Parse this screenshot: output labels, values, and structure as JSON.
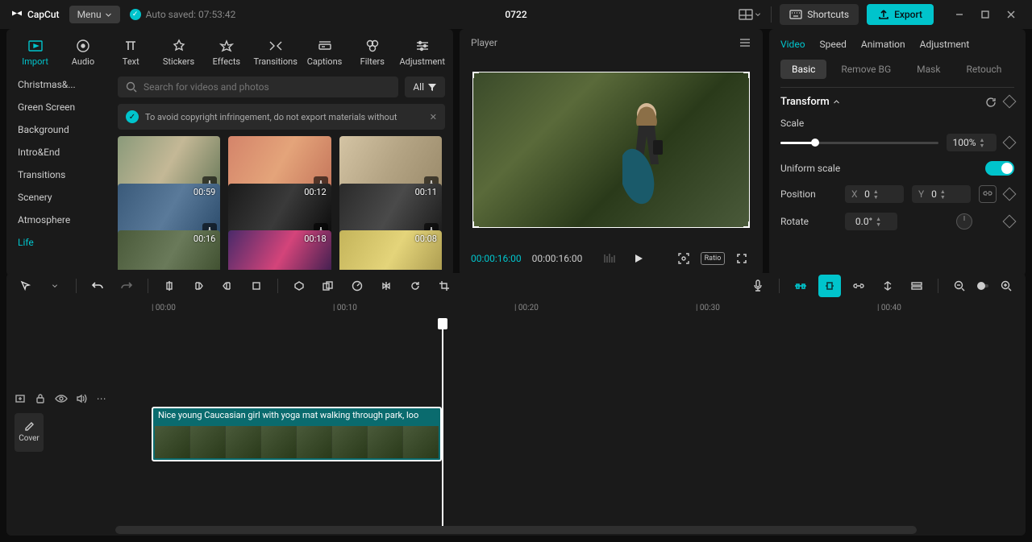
{
  "app": {
    "name": "CapCut",
    "menu": "Menu",
    "autosave": "Auto saved: 07:53:42",
    "project": "0722"
  },
  "titlebar": {
    "shortcuts": "Shortcuts",
    "export": "Export"
  },
  "modeTabs": [
    {
      "label": "Import",
      "active": true
    },
    {
      "label": "Audio"
    },
    {
      "label": "Text"
    },
    {
      "label": "Stickers"
    },
    {
      "label": "Effects"
    },
    {
      "label": "Transitions"
    },
    {
      "label": "Captions"
    },
    {
      "label": "Filters"
    },
    {
      "label": "Adjustment"
    }
  ],
  "categories": [
    "Christmas&...",
    "Green Screen",
    "Background",
    "Intro&End",
    "Transitions",
    "Scenery",
    "Atmosphere",
    "Life"
  ],
  "activeCategory": "Life",
  "search": {
    "placeholder": "Search for videos and photos",
    "filter": "All"
  },
  "banner": "To avoid copyright infringement, do not export materials without",
  "media": [
    {
      "dur": ""
    },
    {
      "dur": ""
    },
    {
      "dur": ""
    },
    {
      "dur": "00:59"
    },
    {
      "dur": "00:12"
    },
    {
      "dur": "00:11"
    },
    {
      "dur": "00:16"
    },
    {
      "dur": "00:18"
    },
    {
      "dur": "00:08"
    }
  ],
  "player": {
    "title": "Player",
    "current": "00:00:16:00",
    "total": "00:00:16:00",
    "ratio": "Ratio"
  },
  "props": {
    "tabs": [
      "Video",
      "Speed",
      "Animation",
      "Adjustment"
    ],
    "activeTab": "Video",
    "subtabs": [
      "Basic",
      "Remove BG",
      "Mask",
      "Retouch"
    ],
    "activeSubtab": "Basic",
    "transform": "Transform",
    "scale": {
      "label": "Scale",
      "value": "100%",
      "pct": 22
    },
    "uniform": "Uniform scale",
    "position": {
      "label": "Position",
      "x": "0",
      "y": "0"
    },
    "rotate": {
      "label": "Rotate",
      "value": "0.0°"
    }
  },
  "timeline": {
    "ticks": [
      "00:00",
      "00:10",
      "00:20",
      "00:30",
      "00:40"
    ],
    "clip": "Nice young Caucasian girl with yoga mat walking through park, loo",
    "cover": "Cover"
  }
}
